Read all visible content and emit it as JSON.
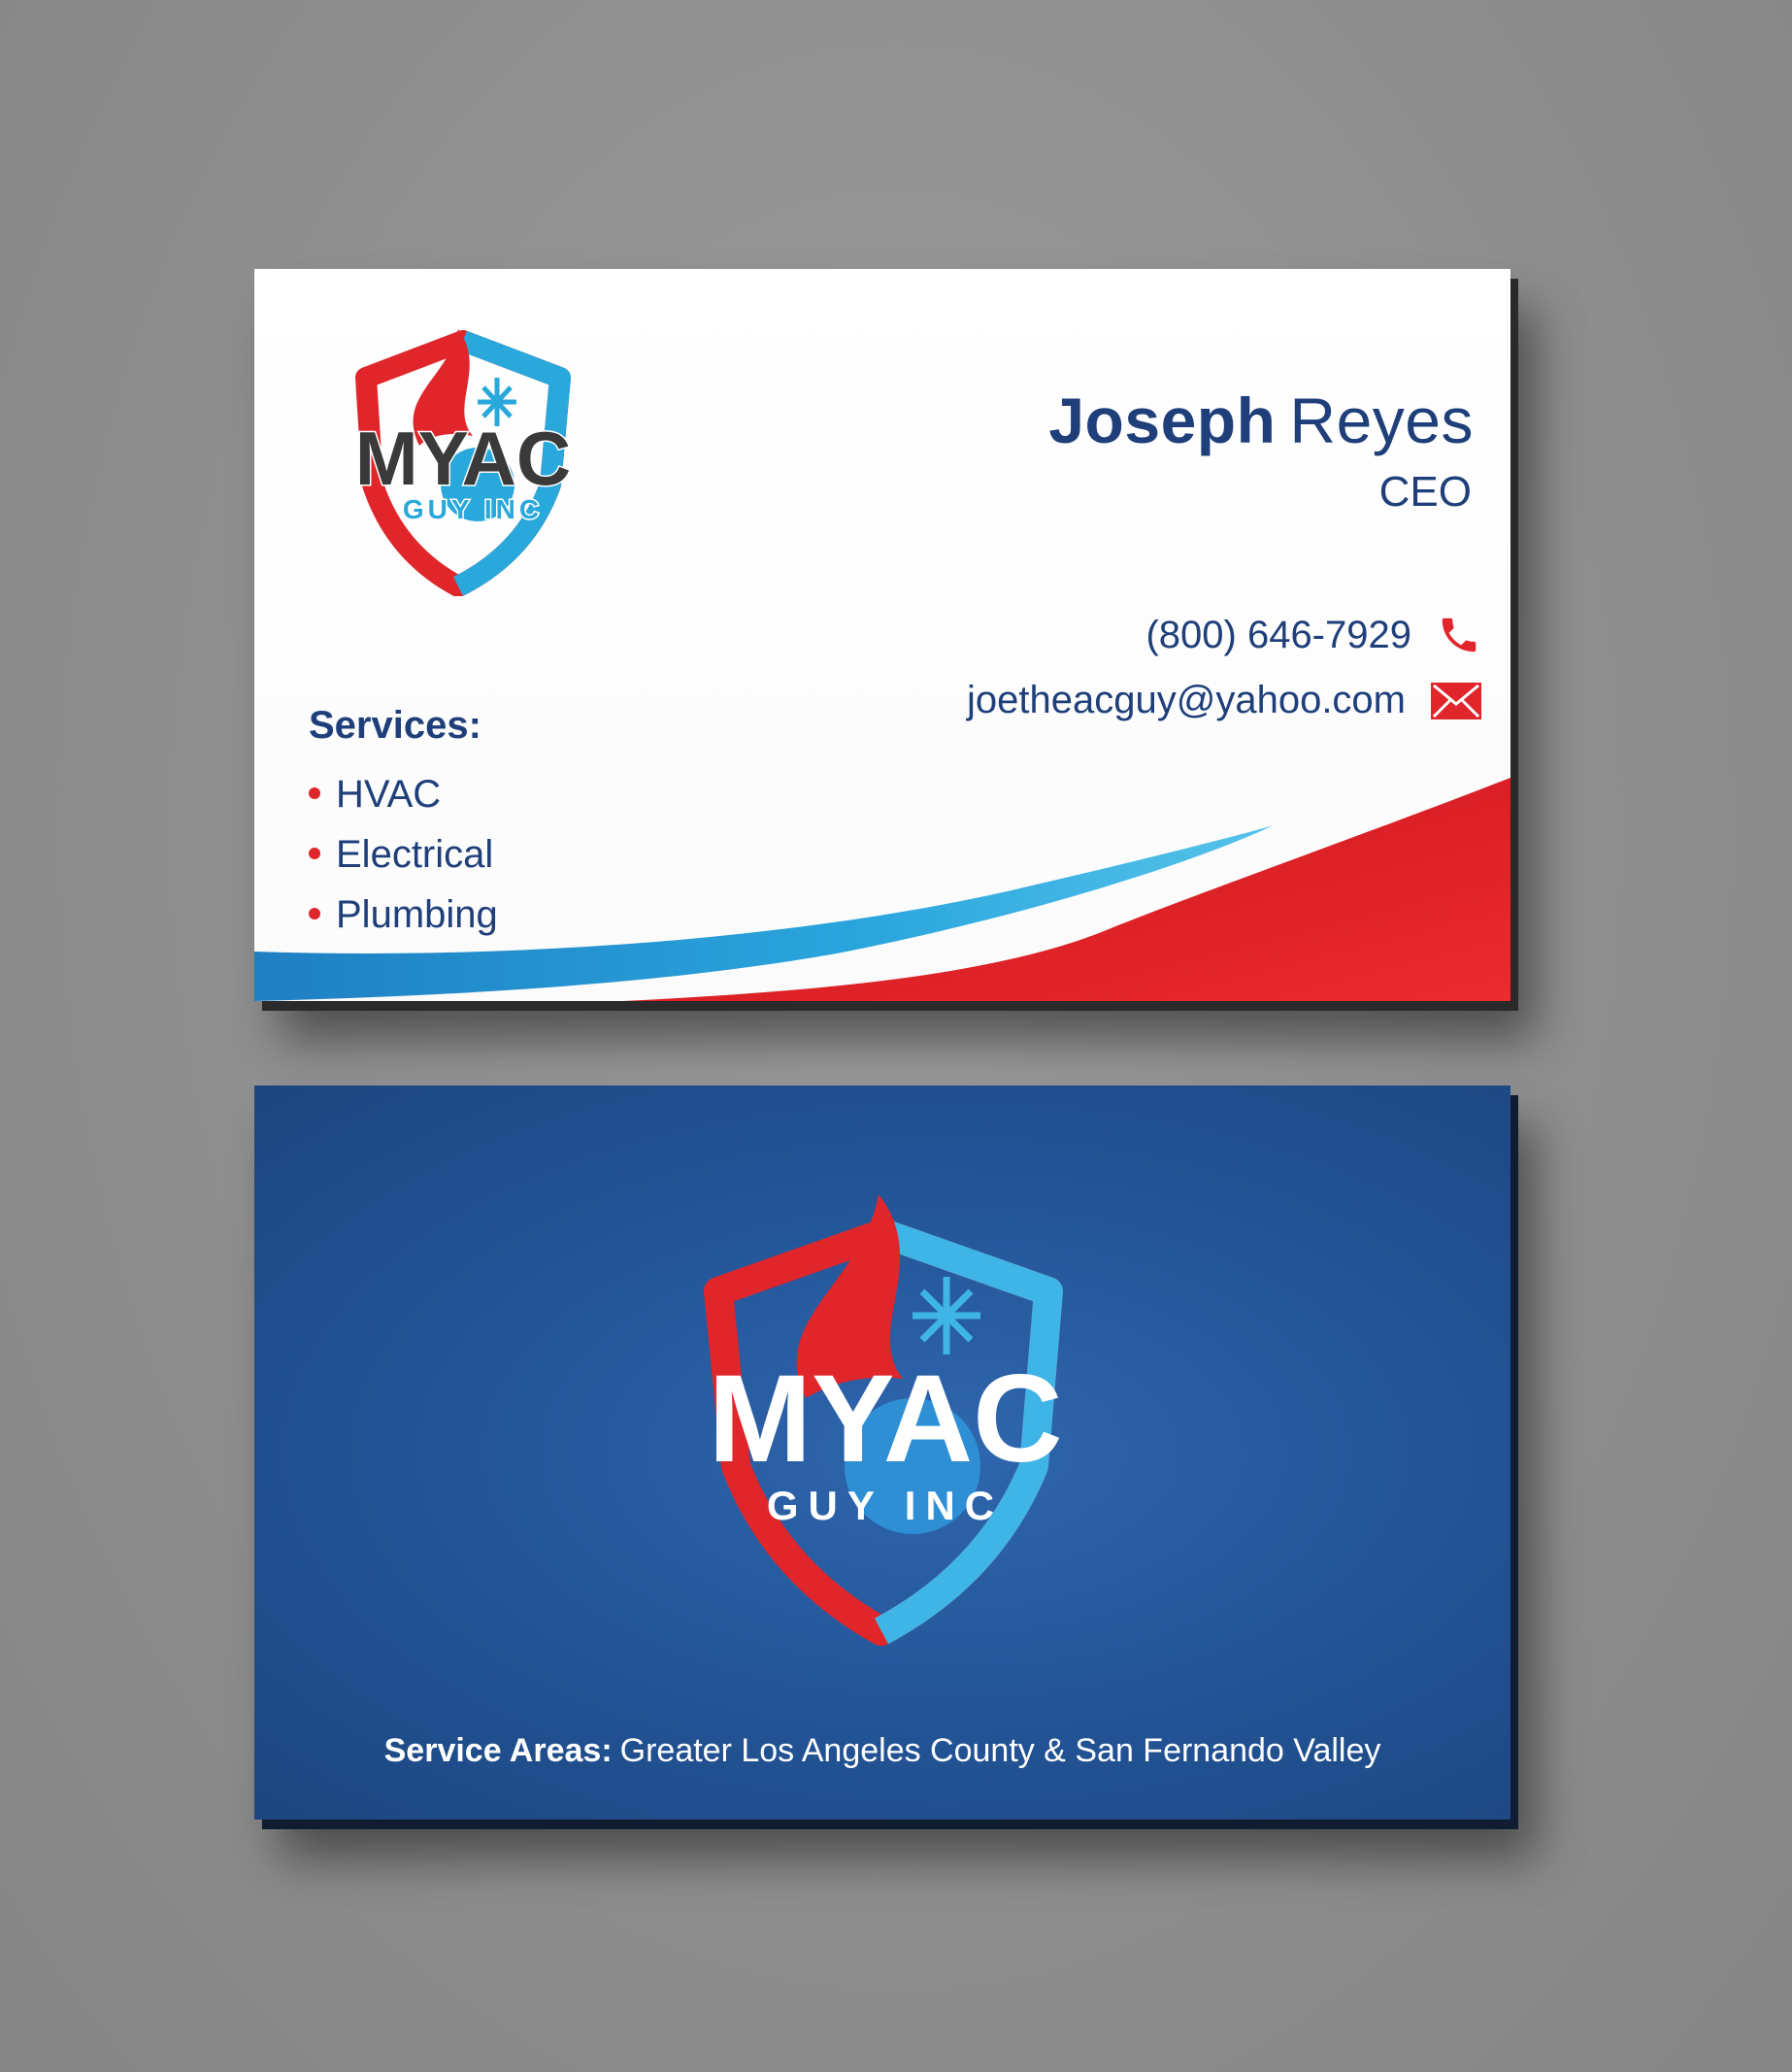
{
  "card_front": {
    "logo": {
      "word1": "MYAC",
      "word2": "GUY INC"
    },
    "first_name": "Joseph",
    "last_name": "Reyes",
    "title": "CEO",
    "phone": "(800) 646-7929",
    "email": "joetheacguy@yahoo.com",
    "services_heading": "Services:",
    "services": [
      "HVAC",
      "Electrical",
      "Plumbing"
    ]
  },
  "card_back": {
    "logo": {
      "word1": "MYAC",
      "word2": "GUY INC"
    },
    "service_areas_label": "Service Areas:",
    "service_areas_value": "Greater Los Angeles County & San Fernando Valley"
  },
  "icons": {
    "phone": "phone-icon",
    "email": "envelope-icon",
    "logo": "flame-snowflake-shield-logo"
  },
  "colors": {
    "brand_navy": "#1f3f7a",
    "brand_red": "#e0262b",
    "brand_light_blue": "#29a8dc",
    "back_card_blue": "#24569a",
    "background_gray": "#959595"
  }
}
